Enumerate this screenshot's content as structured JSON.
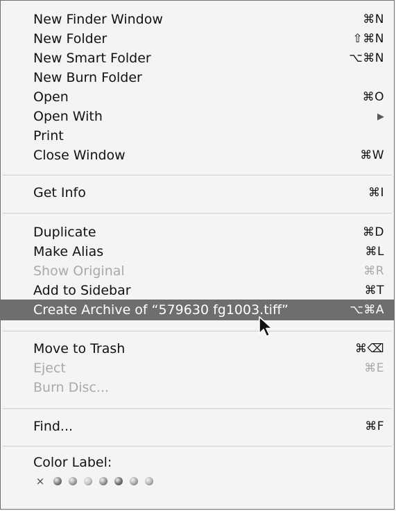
{
  "menu": {
    "items": [
      {
        "label": "New Finder Window",
        "shortcut": "⌘N"
      },
      {
        "label": "New Folder",
        "shortcut": "⇧⌘N"
      },
      {
        "label": "New Smart Folder",
        "shortcut": "⌥⌘N"
      },
      {
        "label": "New Burn Folder",
        "shortcut": ""
      },
      {
        "label": "Open",
        "shortcut": "⌘O"
      },
      {
        "label": "Open With",
        "shortcut": ""
      },
      {
        "label": "Print",
        "shortcut": ""
      },
      {
        "label": "Close Window",
        "shortcut": "⌘W"
      },
      {
        "label": "Get Info",
        "shortcut": "⌘I"
      },
      {
        "label": "Duplicate",
        "shortcut": "⌘D"
      },
      {
        "label": "Make Alias",
        "shortcut": "⌘L"
      },
      {
        "label": "Show Original",
        "shortcut": "⌘R",
        "disabled": true
      },
      {
        "label": "Add to Sidebar",
        "shortcut": "⌘T"
      },
      {
        "label": "Create Archive of “579630 fg1003.tiff”",
        "shortcut": "⌥⌘A",
        "highlighted": true
      },
      {
        "label": "Move to Trash",
        "shortcut": "⌘⌫"
      },
      {
        "label": "Eject",
        "shortcut": "⌘E",
        "disabled": true
      },
      {
        "label": "Burn Disc...",
        "shortcut": "",
        "disabled": true
      },
      {
        "label": "Find...",
        "shortcut": "⌘F"
      }
    ],
    "submenu_arrow_icon": "triangle-right-icon",
    "color_label": {
      "title": "Color Label:",
      "none_symbol": "×",
      "colors": [
        "#7a7a7a",
        "#9c9c9c",
        "#c3c3c3",
        "#909090",
        "#6a6a6a",
        "#a6a6a6",
        "#b2b2b2"
      ]
    }
  }
}
